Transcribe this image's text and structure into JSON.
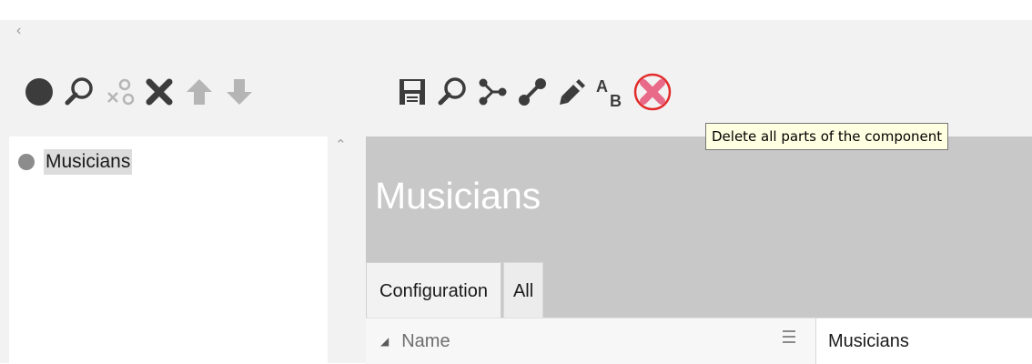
{
  "toolbar_left": {
    "icons": [
      "circle-icon",
      "search-icon",
      "unlink-icon",
      "delete-icon",
      "arrow-up-icon",
      "arrow-down-icon"
    ]
  },
  "toolbar_right": {
    "icons": [
      "save-icon",
      "search-icon",
      "connect-icon",
      "link-icon",
      "pencil-icon",
      "rename-ab-icon",
      "delete-all-icon"
    ]
  },
  "tree": {
    "items": [
      {
        "label": "Musicians"
      }
    ]
  },
  "panel": {
    "title": "Musicians",
    "tabs": [
      {
        "label": "Configuration",
        "active": true
      },
      {
        "label": "All",
        "active": false
      }
    ]
  },
  "grid": {
    "name_header": "Name",
    "value": "Musicians"
  },
  "tooltip": {
    "text": "Delete all parts of the component"
  },
  "colors": {
    "icon_dark": "#3c3c3c",
    "icon_disabled": "#b5b5b5",
    "delete_pink": "#e86a88",
    "highlight_ring": "#e32b2b",
    "panel_gray": "#c8c8c8",
    "tooltip_bg": "#ffffe1"
  }
}
